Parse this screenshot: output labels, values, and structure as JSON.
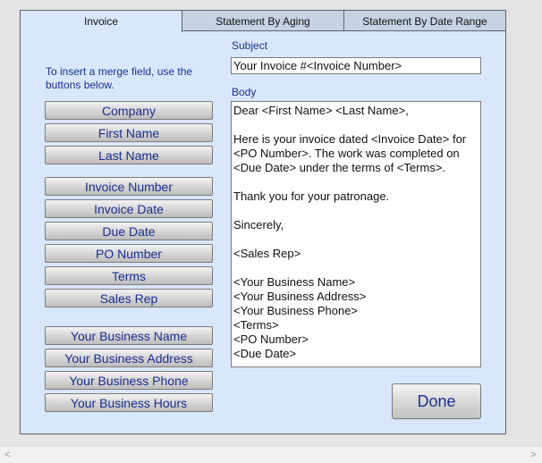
{
  "tabs": [
    {
      "label": "Invoice",
      "active": true
    },
    {
      "label": "Statement By Aging",
      "active": false
    },
    {
      "label": "Statement By Date Range",
      "active": false
    }
  ],
  "hint": "To insert a merge field, use the buttons below.",
  "merge_buttons": {
    "company": "Company",
    "first_name": "First Name",
    "last_name": "Last Name",
    "invoice_number": "Invoice Number",
    "invoice_date": "Invoice Date",
    "due_date": "Due Date",
    "po_number": "PO Number",
    "terms": "Terms",
    "sales_rep": "Sales Rep",
    "business_name": "Your Business Name",
    "business_address": "Your Business Address",
    "business_phone": "Your Business Phone",
    "business_hours": "Your Business Hours"
  },
  "subject": {
    "label": "Subject",
    "value": "Your Invoice #<Invoice Number>"
  },
  "body": {
    "label": "Body",
    "value": "Dear <First Name> <Last Name>,\n\nHere is your invoice dated <Invoice Date> for <PO Number>. The work was completed on <Due Date> under the terms of <Terms>.\n\nThank you for your patronage.\n\nSincerely,\n\n<Sales Rep>\n\n<Your Business Name>\n<Your Business Address>\n<Your Business Phone>\n<Terms>\n<PO Number>\n<Due Date>"
  },
  "done_label": "Done",
  "scrollbar": {
    "left_arrow": "<",
    "right_arrow": ">"
  }
}
